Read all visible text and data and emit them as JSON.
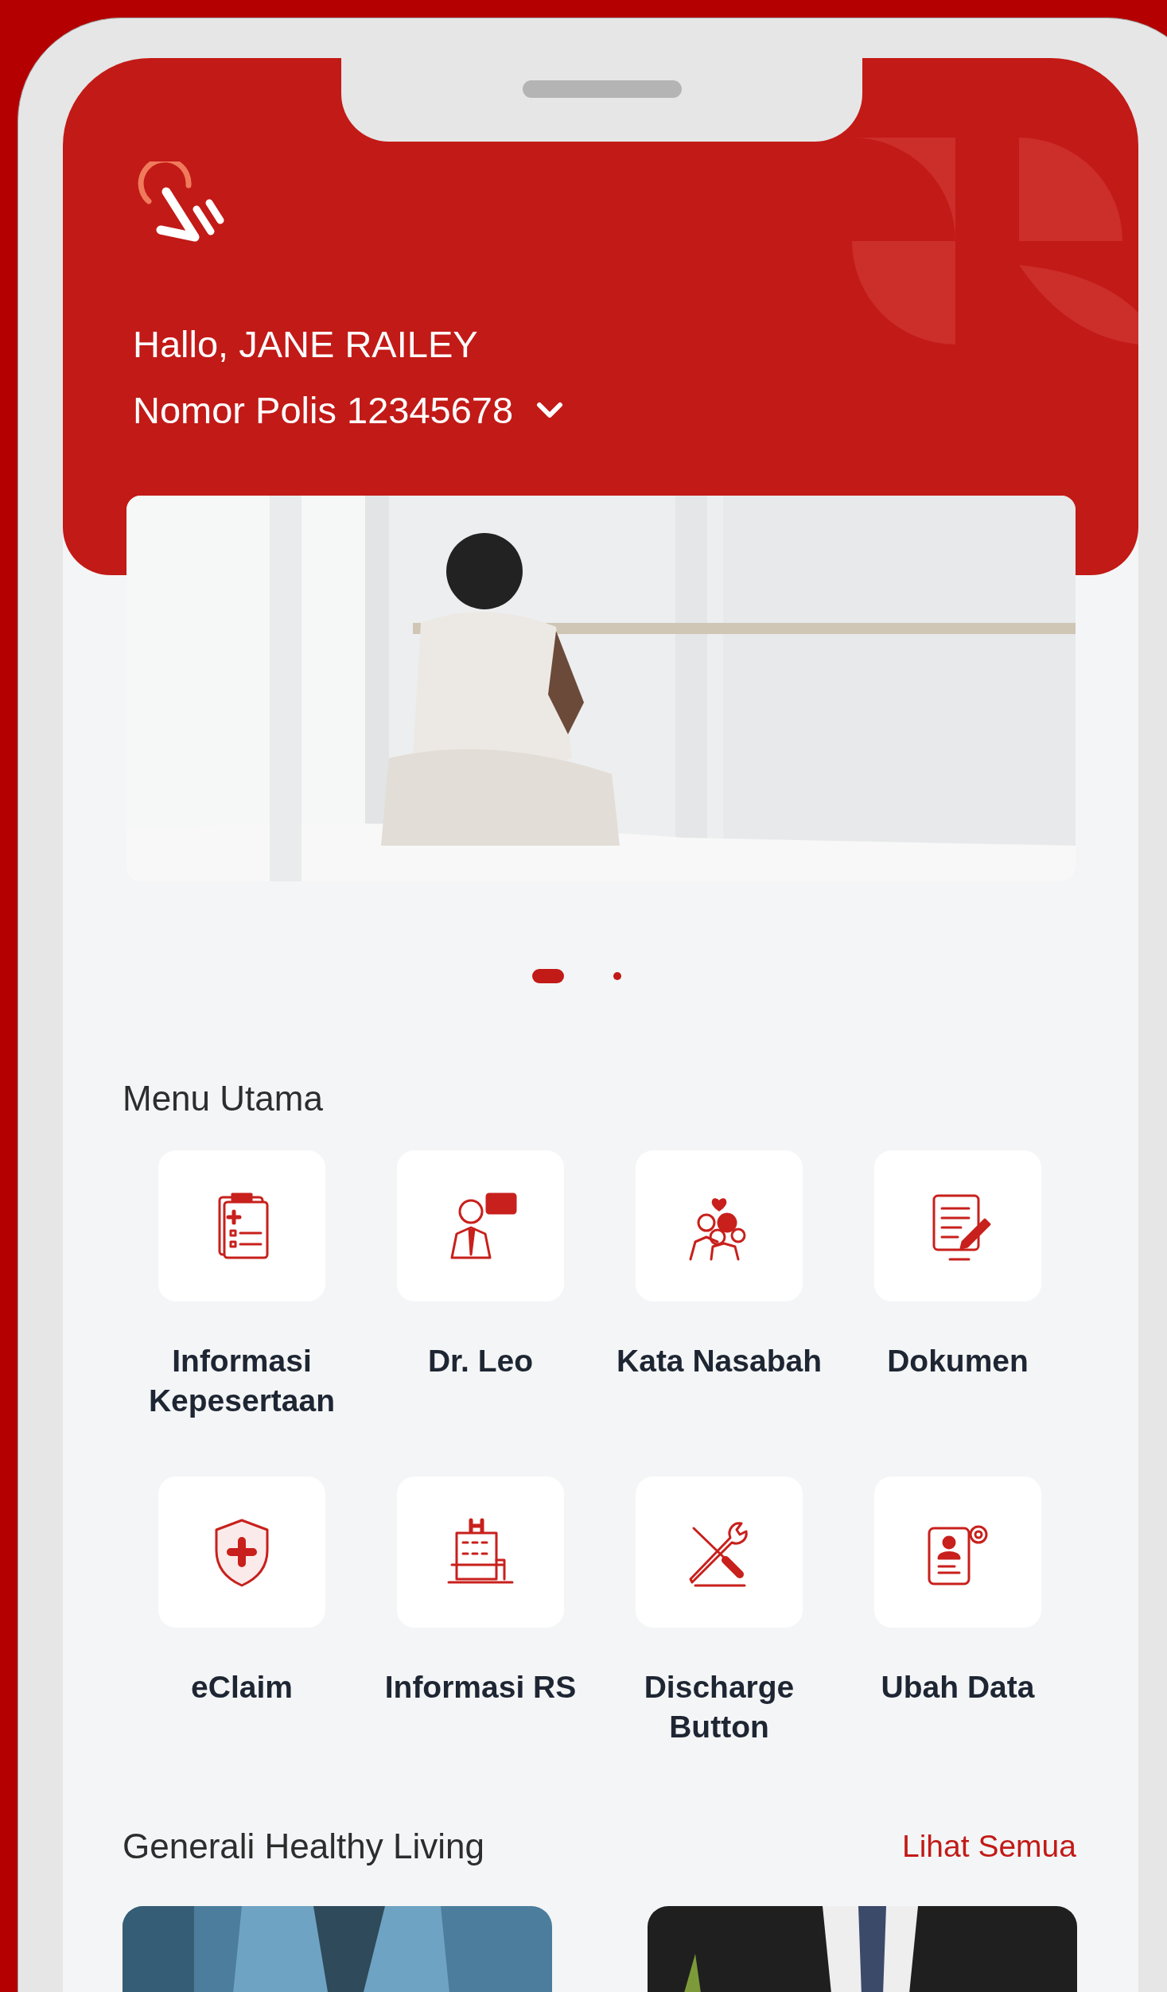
{
  "header": {
    "greeting": "Hallo, JANE RAILEY",
    "policy": "Nomor Polis 12345678"
  },
  "carousel_dots": [
    {
      "selected": true
    },
    {
      "selected": false
    }
  ],
  "main_menu": {
    "title": "Menu Utama",
    "items": [
      {
        "label": "Informasi Kepesertaan",
        "kind": "clipboard"
      },
      {
        "label": "Dr. Leo",
        "kind": "doctor"
      },
      {
        "label": "Kata Nasabah",
        "kind": "family"
      },
      {
        "label": "Dokumen",
        "kind": "document"
      },
      {
        "label": "eClaim",
        "kind": "shield"
      },
      {
        "label": "Informasi RS",
        "kind": "hospital"
      },
      {
        "label": "Discharge Button",
        "kind": "tools"
      },
      {
        "label": "Ubah Data",
        "kind": "profile"
      }
    ]
  },
  "healthy_living": {
    "title": "Generali Healthy Living",
    "link": "Lihat Semua",
    "articles": [
      {
        "kind": "blue"
      },
      {
        "kind": "dark"
      }
    ]
  }
}
